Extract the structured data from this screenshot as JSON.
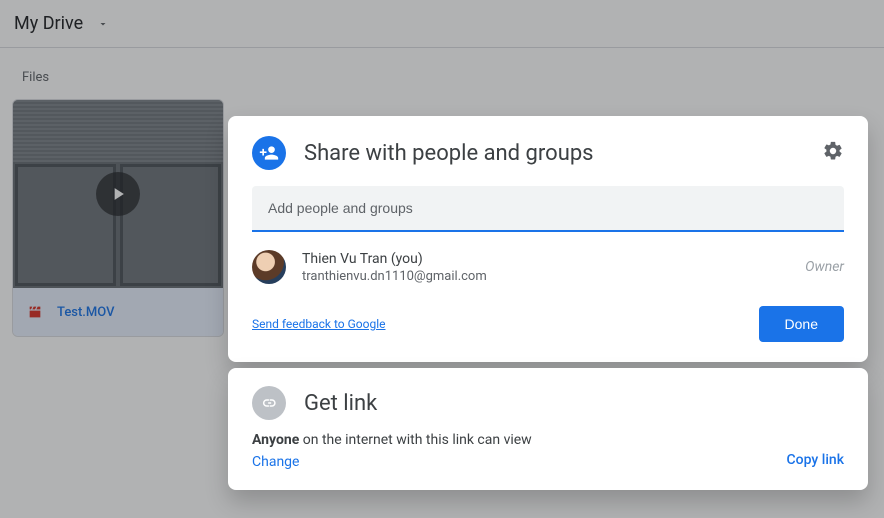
{
  "header": {
    "breadcrumb": "My Drive"
  },
  "content": {
    "section_label": "Files",
    "file": {
      "name": "Test.MOV"
    }
  },
  "share_dialog": {
    "title": "Share with people and groups",
    "add_placeholder": "Add people and groups",
    "user": {
      "name": "Thien Vu Tran (you)",
      "email": "tranthienvu.dn1110@gmail.com",
      "role": "Owner"
    },
    "feedback_label": "Send feedback to Google",
    "done_label": "Done"
  },
  "link_card": {
    "title": "Get link",
    "anyone_label": "Anyone",
    "description_tail": " on the internet with this link can view",
    "change_label": "Change",
    "copy_label": "Copy link"
  }
}
